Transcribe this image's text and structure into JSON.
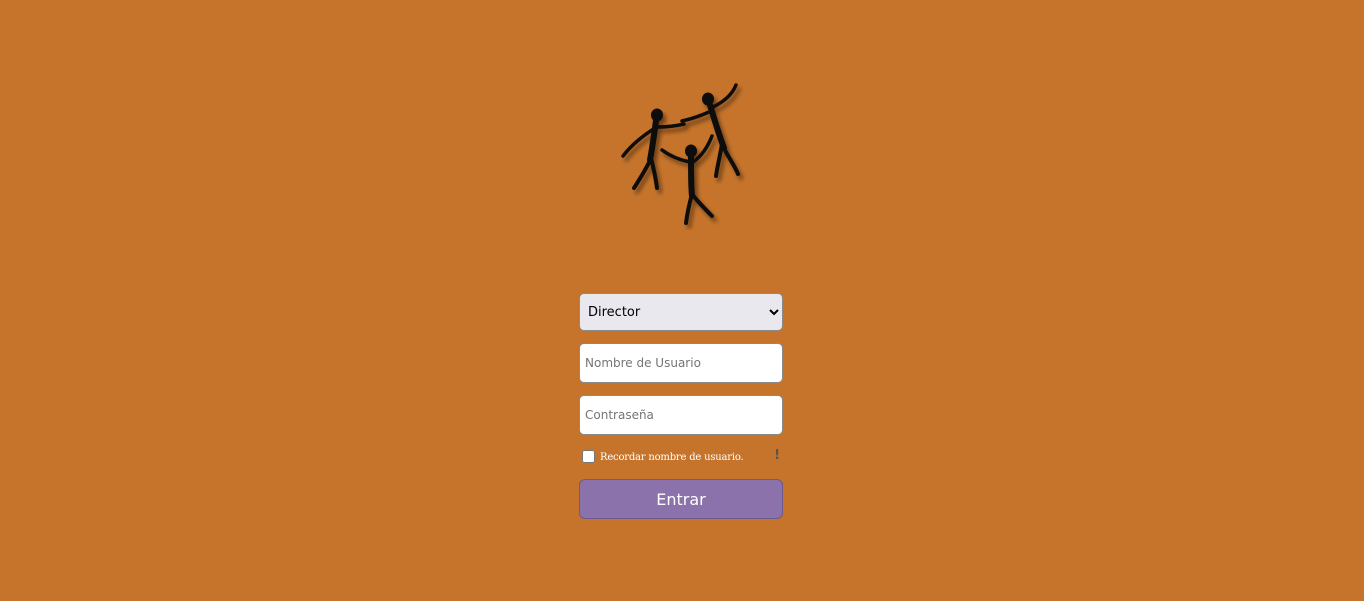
{
  "colors": {
    "background": "#c6742b",
    "button": "#8b72aa",
    "select_bg": "#e9e8ee"
  },
  "logo": {
    "icon": "dancing-people-icon"
  },
  "form": {
    "role_select": {
      "selected": "Director",
      "options": [
        "Director"
      ]
    },
    "username": {
      "placeholder": "Nombre de Usuario",
      "value": ""
    },
    "password": {
      "placeholder": "Contraseña",
      "value": ""
    },
    "remember": {
      "label": "Recordar nombre de usuario.",
      "checked": false
    },
    "alert_mark": "!",
    "submit_label": "Entrar"
  }
}
